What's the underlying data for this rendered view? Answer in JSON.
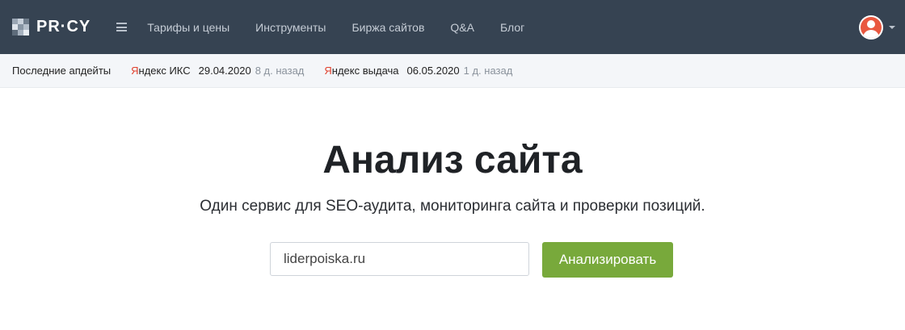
{
  "header": {
    "logo_text": "PR·CY",
    "nav": [
      {
        "label": "Тарифы и цены"
      },
      {
        "label": "Инструменты"
      },
      {
        "label": "Биржа сайтов"
      },
      {
        "label": "Q&A"
      },
      {
        "label": "Блог"
      }
    ],
    "logo_colors": [
      "#9aa6b4",
      "#c7d0da",
      "#6f7d8c",
      "#dfe5ec",
      "#8795a4",
      "#b4bfcb",
      "#5e6c7b",
      "#a7b3c0",
      "#e9eef3"
    ]
  },
  "updates": {
    "title": "Последние апдейты",
    "items": [
      {
        "first_letter": "Я",
        "rest": "ндекс ИКС",
        "date": "29.04.2020",
        "ago": "8 д. назад"
      },
      {
        "first_letter": "Я",
        "rest": "ндекс выдача",
        "date": "06.05.2020",
        "ago": "1 д. назад"
      }
    ]
  },
  "hero": {
    "title": "Анализ сайта",
    "subtitle": "Один сервис для SEO-аудита, мониторинга сайта и проверки позиций.",
    "input_value": "liderpoiska.ru",
    "button_label": "Анализировать"
  },
  "colors": {
    "nav_bg": "#364352",
    "accent_button": "#78a93b",
    "yandex_red": "#e1402d",
    "avatar": "#e9573f"
  },
  "icons": {
    "menu": "hamburger-icon",
    "user": "user-avatar-icon",
    "caret": "chevron-down-icon"
  }
}
